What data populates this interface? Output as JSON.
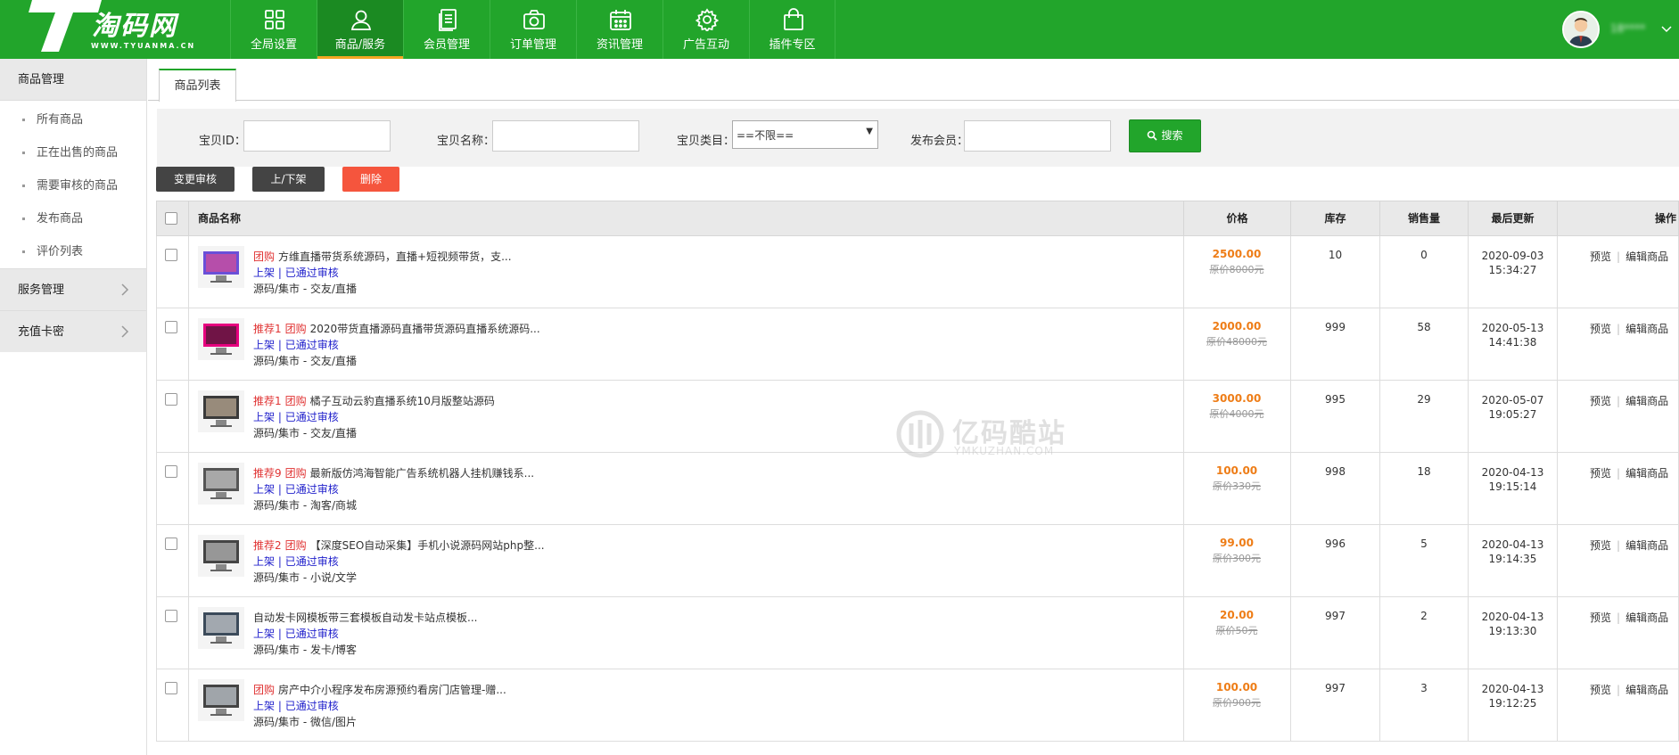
{
  "brand": {
    "name": "淘码网",
    "domain": "WWW.TYUANMA.CN",
    "color": "#22a52b"
  },
  "nav": [
    {
      "label": "全局设置",
      "icon": "grid-icon"
    },
    {
      "label": "商品/服务",
      "icon": "user-icon",
      "active": true
    },
    {
      "label": "会员管理",
      "icon": "document-list-icon"
    },
    {
      "label": "订单管理",
      "icon": "camera-icon"
    },
    {
      "label": "资讯管理",
      "icon": "calendar-icon"
    },
    {
      "label": "广告互动",
      "icon": "gear-icon"
    },
    {
      "label": "插件专区",
      "icon": "shopping-bag-icon"
    }
  ],
  "user": {
    "name": "18****"
  },
  "sidebar": {
    "title": "商品管理",
    "items": [
      "所有商品",
      "正在出售的商品",
      "需要审核的商品",
      "发布商品",
      "评价列表"
    ],
    "groups": [
      "服务管理",
      "充值卡密"
    ]
  },
  "tab": {
    "label": "商品列表"
  },
  "filter": {
    "id_label": "宝贝ID：",
    "name_label": "宝贝名称：",
    "category_label": "宝贝类目：",
    "category_value": "==不限==",
    "member_label": "发布会员：",
    "search_label": "搜索"
  },
  "actions": {
    "review": "变更审核",
    "toggle": "上/下架",
    "delete": "删除"
  },
  "table": {
    "headers": {
      "name": "商品名称",
      "price": "价格",
      "stock": "库存",
      "sales": "销售量",
      "updated": "最后更新",
      "ops": "操作"
    },
    "ops": {
      "preview": "预览",
      "edit": "编辑商品"
    },
    "rows": [
      {
        "tags": [
          "团购"
        ],
        "title": "方维直播带货系统源码，直播+短视频带货，支...",
        "shelf": "上架",
        "review": "已通过审核",
        "category": "源码/集市 - 交友/直播",
        "price": "2500.00",
        "orig": "原价8000元",
        "stock": "10",
        "sales": "0",
        "date": "2020-09-03",
        "time": "15:34:27"
      },
      {
        "tags": [
          "推荐1",
          "团购"
        ],
        "title": "2020带货直播源码直播带货源码直播系统源码...",
        "shelf": "上架",
        "review": "已通过审核",
        "category": "源码/集市 - 交友/直播",
        "price": "2000.00",
        "orig": "原价48000元",
        "stock": "999",
        "sales": "58",
        "date": "2020-05-13",
        "time": "14:41:38"
      },
      {
        "tags": [
          "推荐1",
          "团购"
        ],
        "title": "橘子互动云豹直播系统10月版整站源码",
        "shelf": "上架",
        "review": "已通过审核",
        "category": "源码/集市 - 交友/直播",
        "price": "3000.00",
        "orig": "原价4000元",
        "stock": "995",
        "sales": "29",
        "date": "2020-05-07",
        "time": "19:05:27"
      },
      {
        "tags": [
          "推荐9",
          "团购"
        ],
        "title": "最新版仿鸿海智能广告系统机器人挂机赚钱系...",
        "shelf": "上架",
        "review": "已通过审核",
        "category": "源码/集市 - 淘客/商城",
        "price": "100.00",
        "orig": "原价330元",
        "stock": "998",
        "sales": "18",
        "date": "2020-04-13",
        "time": "19:15:14"
      },
      {
        "tags": [
          "推荐2",
          "团购"
        ],
        "title": "【深度SEO自动采集】手机小说源码网站php整...",
        "shelf": "上架",
        "review": "已通过审核",
        "category": "源码/集市 - 小说/文学",
        "price": "99.00",
        "orig": "原价300元",
        "stock": "996",
        "sales": "5",
        "date": "2020-04-13",
        "time": "19:14:35"
      },
      {
        "tags": [],
        "title": "自动发卡网模板带三套模板自动发卡站点模板...",
        "shelf": "上架",
        "review": "已通过审核",
        "category": "源码/集市 - 发卡/博客",
        "price": "20.00",
        "orig": "原价50元",
        "stock": "997",
        "sales": "2",
        "date": "2020-04-13",
        "time": "19:13:30"
      },
      {
        "tags": [
          "团购"
        ],
        "title": "房产中介小程序发布房源预约看房门店管理-赠...",
        "shelf": "上架",
        "review": "已通过审核",
        "category": "源码/集市 - 微信/图片",
        "price": "100.00",
        "orig": "原价900元",
        "stock": "997",
        "sales": "3",
        "date": "2020-04-13",
        "time": "19:12:25"
      }
    ]
  },
  "watermark": {
    "text": "亿码酷站",
    "sub": "YMKUZHAN.COM"
  }
}
